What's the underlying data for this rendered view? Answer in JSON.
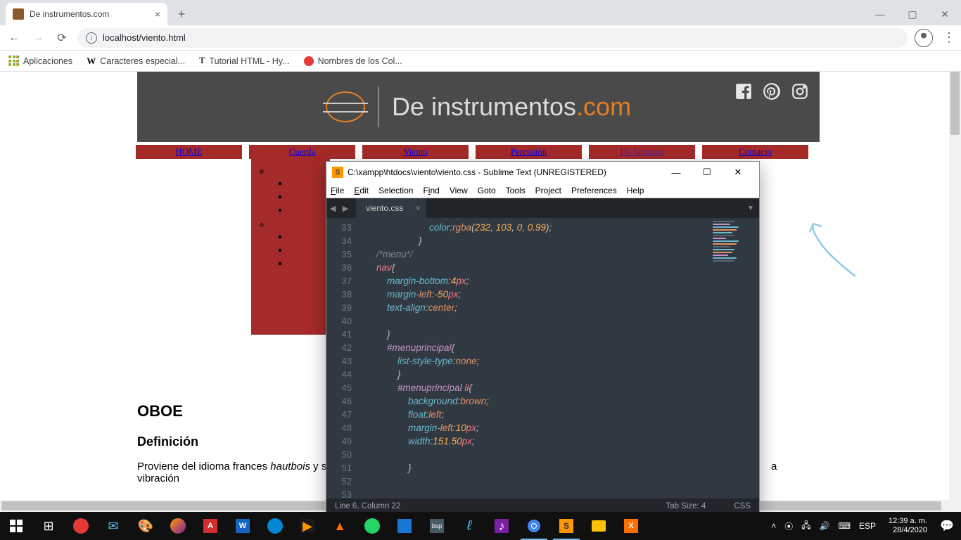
{
  "browser": {
    "tab_title": "De instrumentos.com",
    "url": "localhost/viento.html",
    "bookmarks": [
      "Aplicaciones",
      "Caracteres especial...",
      "Tutorial HTML - Hy...",
      "Nombres de los Col..."
    ]
  },
  "site": {
    "title_a": "De instrumentos",
    "title_b": ".com",
    "nav": [
      "HOME",
      "Cuerda",
      "Viento",
      "Percusión",
      "De famosos",
      "Contacto"
    ]
  },
  "content": {
    "h2": "OBOE",
    "h3": "Definición",
    "para_a": "Proviene del idioma frances ",
    "para_em": "hautbois",
    "para_b": " y sig",
    "para_c": "a vibración"
  },
  "sublime": {
    "title": "C:\\xampp\\htdocs\\viento\\viento.css - Sublime Text (UNREGISTERED)",
    "menus": [
      "File",
      "Edit",
      "Selection",
      "Find",
      "View",
      "Goto",
      "Tools",
      "Project",
      "Preferences",
      "Help"
    ],
    "tab": "viento.css",
    "status_left": "Line 6, Column 22",
    "status_mid": "Tab Size: 4",
    "status_right": "CSS",
    "lines": [
      {
        "n": 33,
        "t": "                        color:rgba(232, 103, 0, 0.99);"
      },
      {
        "n": 34,
        "t": "                    }"
      },
      {
        "n": 35,
        "t": "    /*menu*/"
      },
      {
        "n": 36,
        "t": "    nav{"
      },
      {
        "n": 37,
        "t": "        margin-bottom:4px;"
      },
      {
        "n": 38,
        "t": "        margin-left:-50px;"
      },
      {
        "n": 39,
        "t": "        text-align:center;"
      },
      {
        "n": 40,
        "t": "",
        "mod": true
      },
      {
        "n": 41,
        "t": "        }",
        "mod": true
      },
      {
        "n": 42,
        "t": "        #menuprincipal{"
      },
      {
        "n": 43,
        "t": "            list-style-type:none;"
      },
      {
        "n": 44,
        "t": "            }"
      },
      {
        "n": 45,
        "t": "            #menuprincipal li{"
      },
      {
        "n": 46,
        "t": "                background:brown;",
        "mod": true
      },
      {
        "n": 47,
        "t": "                float:left;",
        "mod": true
      },
      {
        "n": 48,
        "t": "                margin-left:10px;",
        "mod": true
      },
      {
        "n": 49,
        "t": "                width:151.50px;",
        "mod": true
      },
      {
        "n": 50,
        "t": ""
      },
      {
        "n": 51,
        "t": "                }"
      },
      {
        "n": 52,
        "t": ""
      },
      {
        "n": 53,
        "t": ""
      }
    ]
  },
  "taskbar": {
    "lang": "ESP",
    "time": "12:39 a. m.",
    "date": "28/4/2020"
  }
}
